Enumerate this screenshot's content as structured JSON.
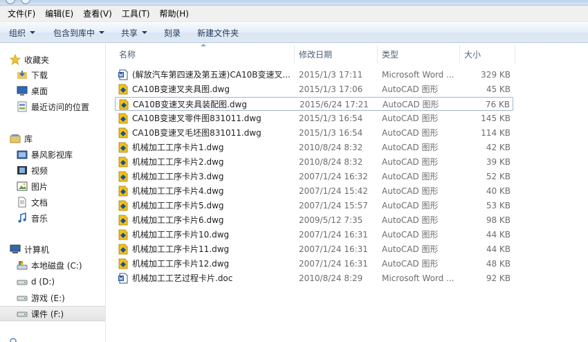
{
  "menu": [
    "文件(F)",
    "编辑(E)",
    "查看(V)",
    "工具(T)",
    "帮助(H)"
  ],
  "toolbar": {
    "organize": "组织",
    "include_in_library": "包含到库中",
    "share": "共享",
    "burn": "刻录",
    "new_folder": "新建文件夹"
  },
  "nav": {
    "favorites": {
      "label": "收藏夹",
      "items": [
        "下载",
        "桌面",
        "最近访问的位置"
      ]
    },
    "libraries": {
      "label": "库",
      "items": [
        "暴风影视库",
        "视频",
        "图片",
        "文档",
        "音乐"
      ]
    },
    "computer": {
      "label": "计算机",
      "items": [
        "本地磁盘 (C:)",
        "d (D:)",
        "游戏 (E:)",
        "课件 (F:)"
      ]
    },
    "selected_item": "课件 (F:)"
  },
  "columns": {
    "name": "名称",
    "date": "修改日期",
    "type": "类型",
    "size": "大小"
  },
  "files": [
    {
      "name": "(解放汽车第四速及第五速)CA10B变速叉...",
      "date": "2015/1/3 17:11",
      "type": "Microsoft Word ...",
      "size": "329 KB",
      "icon": "word-doc-icon"
    },
    {
      "name": "CA10B变速叉夹具图.dwg",
      "date": "2015/1/3 17:06",
      "type": "AutoCAD 图形",
      "size": "45 KB",
      "icon": "dwg-icon"
    },
    {
      "name": "CA10B变速叉夹具装配图.dwg",
      "date": "2015/6/24 17:21",
      "type": "AutoCAD 图形",
      "size": "76 KB",
      "icon": "dwg-icon"
    },
    {
      "name": "CA10B变速叉零件图831011.dwg",
      "date": "2015/1/3 16:54",
      "type": "AutoCAD 图形",
      "size": "145 KB",
      "icon": "dwg-icon"
    },
    {
      "name": "CA10B变速叉毛坯图831011.dwg",
      "date": "2015/1/3 16:54",
      "type": "AutoCAD 图形",
      "size": "114 KB",
      "icon": "dwg-icon"
    },
    {
      "name": "机械加工工序卡片1.dwg",
      "date": "2010/8/24 8:32",
      "type": "AutoCAD 图形",
      "size": "42 KB",
      "icon": "dwg-icon"
    },
    {
      "name": "机械加工工序卡片2.dwg",
      "date": "2010/8/24 8:32",
      "type": "AutoCAD 图形",
      "size": "39 KB",
      "icon": "dwg-icon"
    },
    {
      "name": "机械加工工序卡片3.dwg",
      "date": "2007/1/24 16:32",
      "type": "AutoCAD 图形",
      "size": "52 KB",
      "icon": "dwg-icon"
    },
    {
      "name": "机械加工工序卡片4.dwg",
      "date": "2007/1/24 15:42",
      "type": "AutoCAD 图形",
      "size": "40 KB",
      "icon": "dwg-icon"
    },
    {
      "name": "机械加工工序卡片5.dwg",
      "date": "2007/1/24 15:57",
      "type": "AutoCAD 图形",
      "size": "53 KB",
      "icon": "dwg-icon"
    },
    {
      "name": "机械加工工序卡片6.dwg",
      "date": "2009/5/12 7:35",
      "type": "AutoCAD 图形",
      "size": "98 KB",
      "icon": "dwg-icon"
    },
    {
      "name": "机械加工工序卡片10.dwg",
      "date": "2007/1/24 16:31",
      "type": "AutoCAD 图形",
      "size": "44 KB",
      "icon": "dwg-icon"
    },
    {
      "name": "机械加工工序卡片11.dwg",
      "date": "2007/1/24 16:31",
      "type": "AutoCAD 图形",
      "size": "44 KB",
      "icon": "dwg-icon"
    },
    {
      "name": "机械加工工序卡片12.dwg",
      "date": "2007/1/24 16:31",
      "type": "AutoCAD 图形",
      "size": "48 KB",
      "icon": "dwg-icon"
    },
    {
      "name": "机械加工工艺过程卡片.doc",
      "date": "2010/8/24 8:29",
      "type": "Microsoft Word ...",
      "size": "92 KB",
      "icon": "word-doc-icon"
    }
  ],
  "focused_file": "CA10B变速叉夹具装配图.dwg",
  "colors": {
    "dwg_yellow": "#f2c21b",
    "word_blue": "#2b5797",
    "toolbar_text": "#1e395b"
  }
}
